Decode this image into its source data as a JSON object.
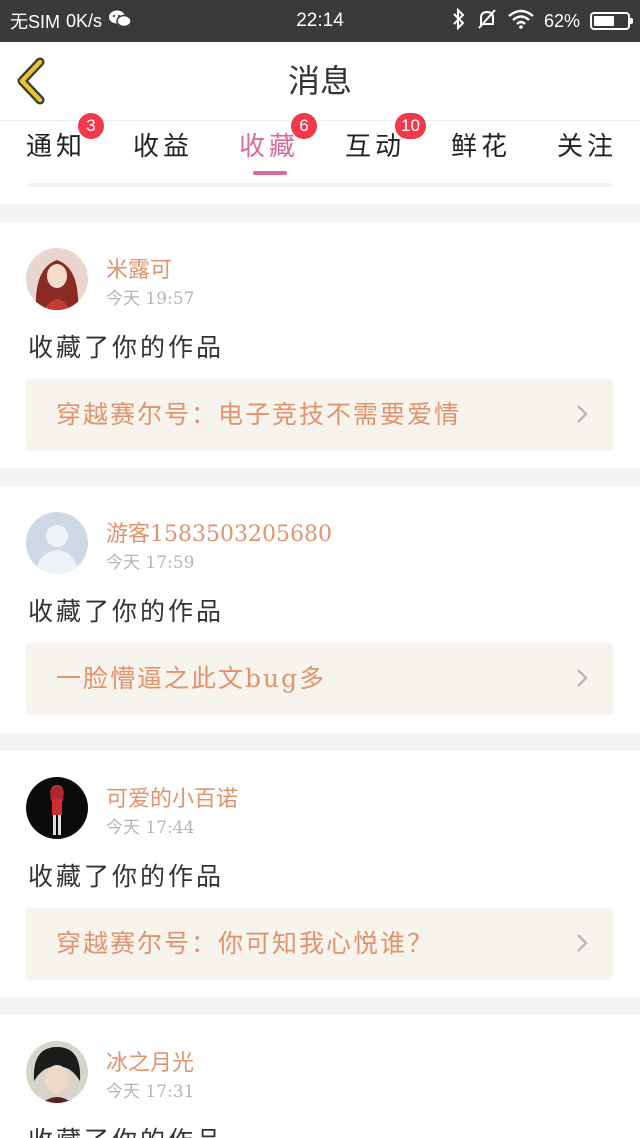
{
  "status_bar": {
    "carrier": "无SIM",
    "speed": "0K/s",
    "time": "22:14",
    "battery": "62%",
    "battery_level": 0.62
  },
  "header": {
    "title": "消息"
  },
  "tabs": [
    {
      "label": "通知",
      "badge": "3"
    },
    {
      "label": "收益",
      "badge": ""
    },
    {
      "label": "收藏",
      "badge": "6",
      "active": true
    },
    {
      "label": "互动",
      "badge": "10"
    },
    {
      "label": "鲜花",
      "badge": ""
    },
    {
      "label": "关注",
      "badge": ""
    }
  ],
  "messages": [
    {
      "name": "米露可",
      "time": "今天 19:57",
      "action": "收藏了你的作品",
      "work": "穿越赛尔号：电子竞技不需要爱情"
    },
    {
      "name": "游客1583503205680",
      "time": "今天 17:59",
      "action": "收藏了你的作品",
      "work": "一脸懵逼之此文bug多"
    },
    {
      "name": "可爱的小百诺",
      "time": "今天 17:44",
      "action": "收藏了你的作品",
      "work": "穿越赛尔号：你可知我心悦谁？"
    },
    {
      "name": "冰之月光",
      "time": "今天 17:31",
      "action": "收藏了你的作品",
      "work": ""
    }
  ],
  "colors": {
    "accent_pink": "#d96a9a",
    "name_orange": "#e3936b",
    "badge_red": "#f2394b",
    "back_yellow": "#e6c62a"
  }
}
